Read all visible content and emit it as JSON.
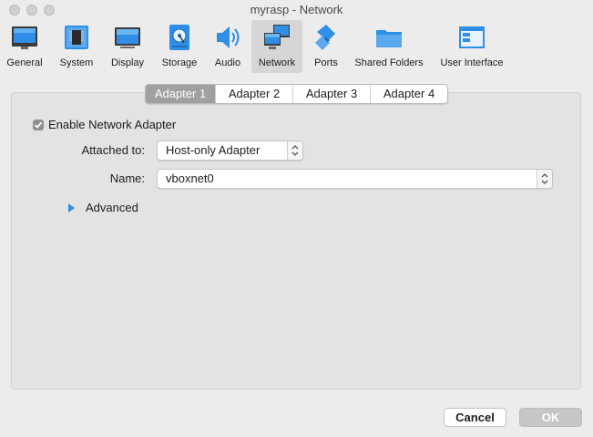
{
  "window": {
    "title": "myrasp - Network"
  },
  "toolbar": {
    "items": [
      {
        "label": "General",
        "icon": "general-icon"
      },
      {
        "label": "System",
        "icon": "system-chip-icon"
      },
      {
        "label": "Display",
        "icon": "display-monitor-icon"
      },
      {
        "label": "Storage",
        "icon": "storage-disk-icon"
      },
      {
        "label": "Audio",
        "icon": "audio-speaker-icon"
      },
      {
        "label": "Network",
        "icon": "network-icon",
        "active": true
      },
      {
        "label": "Ports",
        "icon": "ports-icon"
      },
      {
        "label": "Shared Folders",
        "icon": "shared-folder-icon"
      },
      {
        "label": "User Interface",
        "icon": "user-interface-icon"
      }
    ]
  },
  "tabs": [
    {
      "label": "Adapter 1",
      "active": true
    },
    {
      "label": "Adapter 2"
    },
    {
      "label": "Adapter 3"
    },
    {
      "label": "Adapter 4"
    }
  ],
  "adapter": {
    "enable_label": "Enable Network Adapter",
    "enabled": true,
    "attached_label": "Attached to:",
    "attached_value": "Host-only Adapter",
    "name_label": "Name:",
    "name_value": "vboxnet0",
    "advanced_label": "Advanced"
  },
  "buttons": {
    "cancel": "Cancel",
    "ok": "OK"
  },
  "colors": {
    "accent": "#2f8ee5",
    "window_bg": "#ececec",
    "panel_bg": "#e3e3e3"
  }
}
